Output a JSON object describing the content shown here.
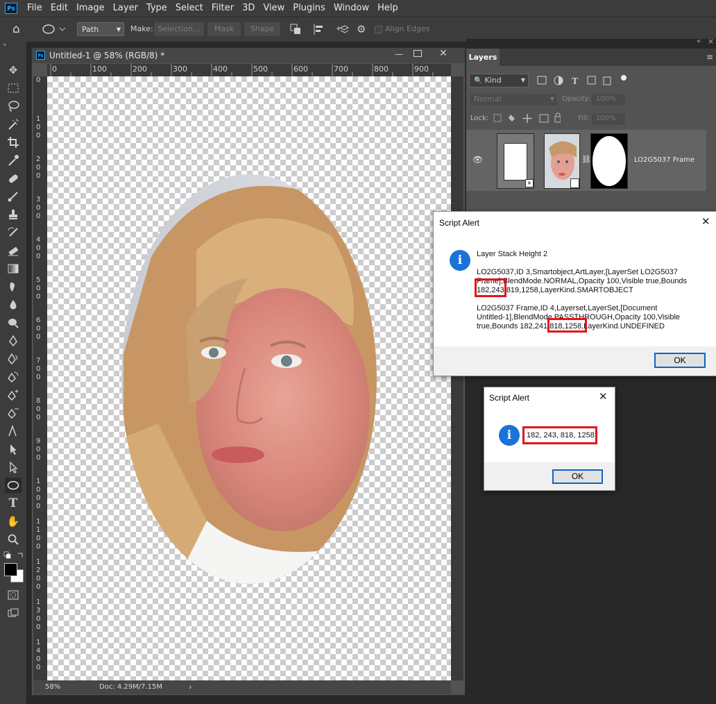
{
  "menubar": {
    "logo": "Ps",
    "items": [
      "File",
      "Edit",
      "Image",
      "Layer",
      "Type",
      "Select",
      "Filter",
      "3D",
      "View",
      "Plugins",
      "Window",
      "Help"
    ]
  },
  "options_bar": {
    "mode_value": "Path",
    "make_label": "Make:",
    "selection_label": "Selection...",
    "mask_label": "Mask",
    "shape_label": "Shape",
    "align_edges_label": "Align Edges"
  },
  "document": {
    "title": "Untitled-1 @ 58% (RGB/8) *",
    "icon": "Ps",
    "ruler_top": [
      "0",
      "100",
      "200",
      "300",
      "400",
      "500",
      "600",
      "700",
      "800",
      "900"
    ],
    "ruler_left": [
      "0",
      "1 0 0",
      "2 0 0",
      "3 0 0",
      "4 0 0",
      "5 0 0",
      "6 0 0",
      "7 0 0",
      "8 0 0",
      "9 0 0",
      "1 0 0 0",
      "1 1 0 0",
      "1 2 0 0",
      "1 3 0 0",
      "1 4 0 0"
    ],
    "status_zoom": "58%",
    "status_doc": "Doc: 4.29M/7.15M"
  },
  "layers_panel": {
    "tab_label": "Layers",
    "filter_kind": "Kind",
    "blend_mode": "Normal",
    "opacity_label": "Opacity:",
    "opacity_value": "100%",
    "lock_label": "Lock:",
    "fill_label": "Fill:",
    "fill_value": "100%",
    "layer_name": "LO2G5037 Frame"
  },
  "alert1": {
    "title": "Script Alert",
    "heading": "Layer Stack Height 2",
    "para1_line1": "LO2G5037,ID 3,Smartobject,ArtLayer,[LayerSet LO2G5037",
    "para1_line2": "Frame],BlendMode.NORMAL,Opacity 100,Visible true,Bounds",
    "para1_line3": "182,243,819,1258,LayerKind.SMARTOBJECT",
    "para2_line1": "LO2G5037 Frame,ID 4,Layerset,LayerSet,[Document",
    "para2_line2": "Untitled-1],BlendMode.PASSTHROUGH,Opacity 100,Visible",
    "para2_line3": "true,Bounds 182,241,818,1258,LayerKind.UNDEFINED",
    "ok_label": "OK"
  },
  "alert2": {
    "title": "Script Alert",
    "message": "182, 243, 818, 1258",
    "ok_label": "OK"
  },
  "colors": {
    "highlight": "#e2141c",
    "accent": "#1a73d8"
  }
}
